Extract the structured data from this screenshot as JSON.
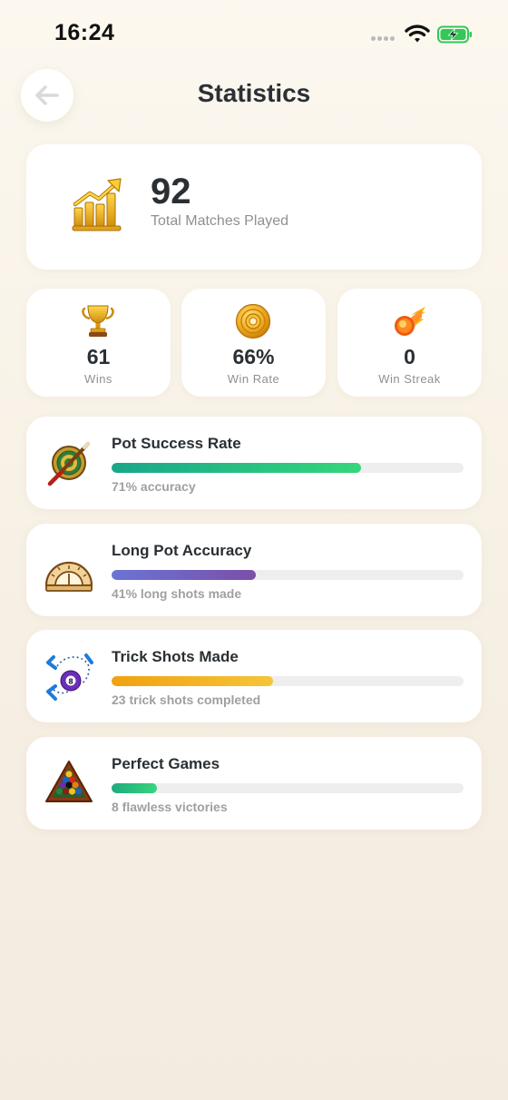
{
  "status_bar": {
    "time": "16:24"
  },
  "header": {
    "title": "Statistics",
    "back_icon": "arrow-left-icon"
  },
  "total": {
    "value": "92",
    "label": "Total Matches Played",
    "icon": "rising-bar-chart-icon"
  },
  "summary": [
    {
      "value": "61",
      "label": "Wins",
      "icon": "trophy-icon"
    },
    {
      "value": "66%",
      "label": "Win Rate",
      "icon": "gold-medal-icon"
    },
    {
      "value": "0",
      "label": "Win Streak",
      "icon": "fireball-icon"
    }
  ],
  "stats": [
    {
      "title": "Pot Success Rate",
      "progress": 0.71,
      "subtitle": "71% accuracy",
      "icon": "target-cue-icon",
      "bar_colors": [
        "#19a68a",
        "#36d67a"
      ]
    },
    {
      "title": "Long Pot Accuracy",
      "progress": 0.41,
      "subtitle": "41% long shots made",
      "icon": "protractor-icon",
      "bar_colors": [
        "#6b74d6",
        "#7a4fa8"
      ]
    },
    {
      "title": "Trick Shots Made",
      "progress": 0.46,
      "subtitle": "23 trick shots completed",
      "icon": "eight-ball-trick-icon",
      "bar_colors": [
        "#f0a10f",
        "#f5c53a"
      ]
    },
    {
      "title": "Perfect Games",
      "progress": 0.13,
      "subtitle": "8 flawless victories",
      "icon": "ball-rack-icon",
      "bar_colors": [
        "#1eaa7e",
        "#38d47e"
      ]
    }
  ]
}
